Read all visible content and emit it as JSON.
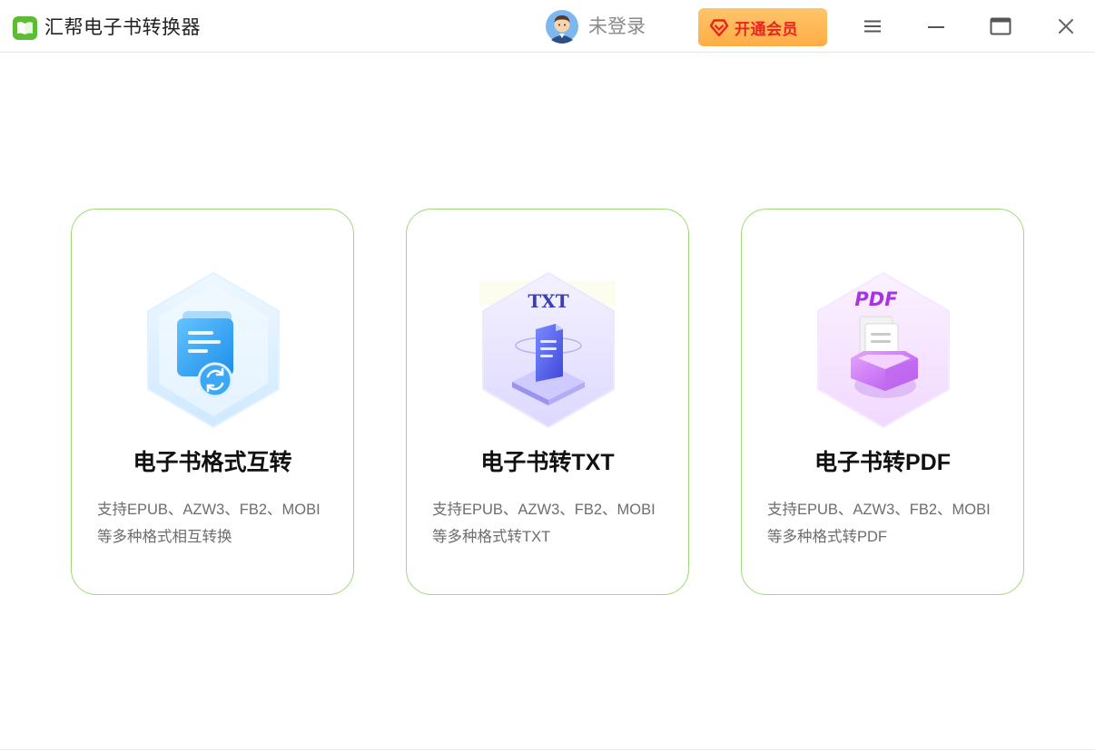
{
  "app": {
    "title": "汇帮电子书转换器",
    "logo_icon": "book-icon",
    "accent_color": "#6bc43c"
  },
  "header": {
    "user_status": "未登录",
    "vip_label": "开通会员",
    "vip_color": "#ffb24f",
    "vip_text_color": "#e8241f",
    "window_controls": [
      "menu-icon",
      "minimize-icon",
      "maximize-icon",
      "close-icon"
    ]
  },
  "cards": [
    {
      "title": "电子书格式互转",
      "desc_line1": "支持EPUB、AZW3、FB2、MOBI",
      "desc_line2": "等多种格式相互转换",
      "icon": "ebook-convert-icon"
    },
    {
      "title": "电子书转TXT",
      "illus_label": "TXT",
      "desc_line1": "支持EPUB、AZW3、FB2、MOBI",
      "desc_line2": "等多种格式转TXT",
      "icon": "txt-document-icon"
    },
    {
      "title": "电子书转PDF",
      "illus_label": "PDF",
      "desc_line1": "支持EPUB、AZW3、FB2、MOBI",
      "desc_line2": "等多种格式转PDF",
      "icon": "pdf-tray-icon"
    }
  ],
  "card_border_color": "#9fd978"
}
